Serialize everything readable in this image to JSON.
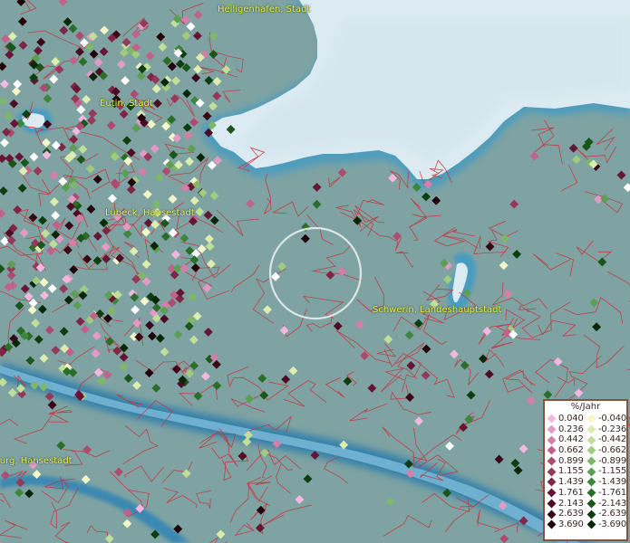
{
  "map": {
    "place_labels": [
      {
        "id": "heiligenhafen",
        "text": "Heiligenhafen, Stadt"
      },
      {
        "id": "eutin",
        "text": "Eutin, Stadt"
      },
      {
        "id": "luebeck",
        "text": "Lübeck, Hansestadt"
      },
      {
        "id": "schwerin",
        "text": "Schwerin, Landeshauptstadt"
      },
      {
        "id": "hamburg",
        "text": "Hamburg, Hansestadt"
      }
    ],
    "colors": {
      "land": "#7fa3a3",
      "water": "#dcebf2",
      "border": "#c8303a",
      "highlight_circle": "#e8eef0"
    }
  },
  "legend": {
    "title": "%/Jahr",
    "positive": [
      {
        "value": "0.040",
        "color": "#f2b8e0"
      },
      {
        "value": "0.236",
        "color": "#e49ac6"
      },
      {
        "value": "0.442",
        "color": "#d47ea8"
      },
      {
        "value": "0.662",
        "color": "#c2628a"
      },
      {
        "value": "0.899",
        "color": "#ac4c70"
      },
      {
        "value": "1.155",
        "color": "#96385a"
      },
      {
        "value": "1.439",
        "color": "#7e2646"
      },
      {
        "value": "1.761",
        "color": "#661634"
      },
      {
        "value": "2.143",
        "color": "#4e0c24"
      },
      {
        "value": "2.639",
        "color": "#380616"
      },
      {
        "value": "3.690",
        "color": "#22020a"
      }
    ],
    "negative": [
      {
        "value": "-0.040",
        "color": "#f4f8c8"
      },
      {
        "value": "-0.236",
        "color": "#dcedb0"
      },
      {
        "value": "-0.442",
        "color": "#c0df98"
      },
      {
        "value": "-0.662",
        "color": "#a0cc80"
      },
      {
        "value": "-0.899",
        "color": "#7eb66a"
      },
      {
        "value": "-1.155",
        "color": "#5c9e52"
      },
      {
        "value": "-1.439",
        "color": "#3e863c"
      },
      {
        "value": "-1.761",
        "color": "#2a6e2a"
      },
      {
        "value": "-2.143",
        "color": "#1a561c"
      },
      {
        "value": "-2.639",
        "color": "#0e3e10"
      },
      {
        "value": "-3.690",
        "color": "#062806"
      }
    ]
  }
}
